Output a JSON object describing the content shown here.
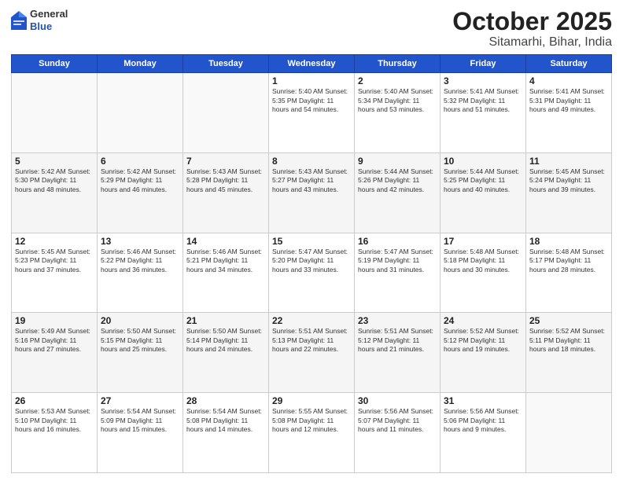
{
  "header": {
    "logo_general": "General",
    "logo_blue": "Blue",
    "month": "October 2025",
    "location": "Sitamarhi, Bihar, India"
  },
  "weekdays": [
    "Sunday",
    "Monday",
    "Tuesday",
    "Wednesday",
    "Thursday",
    "Friday",
    "Saturday"
  ],
  "weeks": [
    [
      {
        "day": "",
        "info": ""
      },
      {
        "day": "",
        "info": ""
      },
      {
        "day": "",
        "info": ""
      },
      {
        "day": "1",
        "info": "Sunrise: 5:40 AM\nSunset: 5:35 PM\nDaylight: 11 hours\nand 54 minutes."
      },
      {
        "day": "2",
        "info": "Sunrise: 5:40 AM\nSunset: 5:34 PM\nDaylight: 11 hours\nand 53 minutes."
      },
      {
        "day": "3",
        "info": "Sunrise: 5:41 AM\nSunset: 5:32 PM\nDaylight: 11 hours\nand 51 minutes."
      },
      {
        "day": "4",
        "info": "Sunrise: 5:41 AM\nSunset: 5:31 PM\nDaylight: 11 hours\nand 49 minutes."
      }
    ],
    [
      {
        "day": "5",
        "info": "Sunrise: 5:42 AM\nSunset: 5:30 PM\nDaylight: 11 hours\nand 48 minutes."
      },
      {
        "day": "6",
        "info": "Sunrise: 5:42 AM\nSunset: 5:29 PM\nDaylight: 11 hours\nand 46 minutes."
      },
      {
        "day": "7",
        "info": "Sunrise: 5:43 AM\nSunset: 5:28 PM\nDaylight: 11 hours\nand 45 minutes."
      },
      {
        "day": "8",
        "info": "Sunrise: 5:43 AM\nSunset: 5:27 PM\nDaylight: 11 hours\nand 43 minutes."
      },
      {
        "day": "9",
        "info": "Sunrise: 5:44 AM\nSunset: 5:26 PM\nDaylight: 11 hours\nand 42 minutes."
      },
      {
        "day": "10",
        "info": "Sunrise: 5:44 AM\nSunset: 5:25 PM\nDaylight: 11 hours\nand 40 minutes."
      },
      {
        "day": "11",
        "info": "Sunrise: 5:45 AM\nSunset: 5:24 PM\nDaylight: 11 hours\nand 39 minutes."
      }
    ],
    [
      {
        "day": "12",
        "info": "Sunrise: 5:45 AM\nSunset: 5:23 PM\nDaylight: 11 hours\nand 37 minutes."
      },
      {
        "day": "13",
        "info": "Sunrise: 5:46 AM\nSunset: 5:22 PM\nDaylight: 11 hours\nand 36 minutes."
      },
      {
        "day": "14",
        "info": "Sunrise: 5:46 AM\nSunset: 5:21 PM\nDaylight: 11 hours\nand 34 minutes."
      },
      {
        "day": "15",
        "info": "Sunrise: 5:47 AM\nSunset: 5:20 PM\nDaylight: 11 hours\nand 33 minutes."
      },
      {
        "day": "16",
        "info": "Sunrise: 5:47 AM\nSunset: 5:19 PM\nDaylight: 11 hours\nand 31 minutes."
      },
      {
        "day": "17",
        "info": "Sunrise: 5:48 AM\nSunset: 5:18 PM\nDaylight: 11 hours\nand 30 minutes."
      },
      {
        "day": "18",
        "info": "Sunrise: 5:48 AM\nSunset: 5:17 PM\nDaylight: 11 hours\nand 28 minutes."
      }
    ],
    [
      {
        "day": "19",
        "info": "Sunrise: 5:49 AM\nSunset: 5:16 PM\nDaylight: 11 hours\nand 27 minutes."
      },
      {
        "day": "20",
        "info": "Sunrise: 5:50 AM\nSunset: 5:15 PM\nDaylight: 11 hours\nand 25 minutes."
      },
      {
        "day": "21",
        "info": "Sunrise: 5:50 AM\nSunset: 5:14 PM\nDaylight: 11 hours\nand 24 minutes."
      },
      {
        "day": "22",
        "info": "Sunrise: 5:51 AM\nSunset: 5:13 PM\nDaylight: 11 hours\nand 22 minutes."
      },
      {
        "day": "23",
        "info": "Sunrise: 5:51 AM\nSunset: 5:12 PM\nDaylight: 11 hours\nand 21 minutes."
      },
      {
        "day": "24",
        "info": "Sunrise: 5:52 AM\nSunset: 5:12 PM\nDaylight: 11 hours\nand 19 minutes."
      },
      {
        "day": "25",
        "info": "Sunrise: 5:52 AM\nSunset: 5:11 PM\nDaylight: 11 hours\nand 18 minutes."
      }
    ],
    [
      {
        "day": "26",
        "info": "Sunrise: 5:53 AM\nSunset: 5:10 PM\nDaylight: 11 hours\nand 16 minutes."
      },
      {
        "day": "27",
        "info": "Sunrise: 5:54 AM\nSunset: 5:09 PM\nDaylight: 11 hours\nand 15 minutes."
      },
      {
        "day": "28",
        "info": "Sunrise: 5:54 AM\nSunset: 5:08 PM\nDaylight: 11 hours\nand 14 minutes."
      },
      {
        "day": "29",
        "info": "Sunrise: 5:55 AM\nSunset: 5:08 PM\nDaylight: 11 hours\nand 12 minutes."
      },
      {
        "day": "30",
        "info": "Sunrise: 5:56 AM\nSunset: 5:07 PM\nDaylight: 11 hours\nand 11 minutes."
      },
      {
        "day": "31",
        "info": "Sunrise: 5:56 AM\nSunset: 5:06 PM\nDaylight: 11 hours\nand 9 minutes."
      },
      {
        "day": "",
        "info": ""
      }
    ]
  ]
}
